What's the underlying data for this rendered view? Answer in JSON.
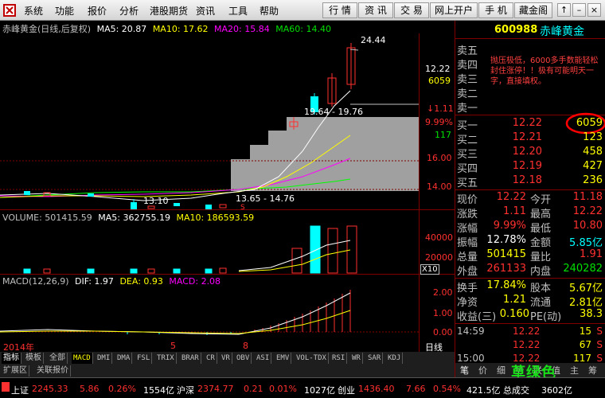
{
  "menubar": {
    "items": [
      "系统",
      "功能",
      "报价",
      "分析",
      "港股期货",
      "资讯",
      "工具",
      "帮助"
    ],
    "buttons": [
      "行 情",
      "资 讯",
      "交 易",
      "网上开户",
      "手 机",
      "藏金阁"
    ],
    "window_controls": [
      "↑",
      "–",
      "×"
    ]
  },
  "chart": {
    "title": "赤峰黄金(日线,后复权)",
    "ma5": "MA5: 20.87",
    "ma10": "MA10: 17.62",
    "ma20": "MA20: 15.84",
    "ma60": "MA60: 14.40",
    "price_axis": [
      "16.00",
      "14.00"
    ],
    "ann_high": "24.44",
    "ann_mid": "19.64 - 19.76",
    "ann_low1": "13.10",
    "ann_low2": "13.65 - 14.76",
    "marker_s": "S",
    "cursor_price": "12.22",
    "cursor_vol": "6059",
    "cursor_chg": "↓1.11",
    "cursor_pct": "9.99%",
    "cursor_cnt": "117",
    "volume_line": {
      "vol": "VOLUME: 501415.59",
      "ma5": "MA5: 362755.19",
      "ma10": "MA10: 186593.59"
    },
    "vol_axis": [
      "40000",
      "20000"
    ],
    "vol_unit": "X10",
    "macd_line": {
      "title": "MACD(12,26,9)",
      "dif": "DIF: 1.97",
      "dea": "DEA: 0.93",
      "macd": "MACD: 2.08"
    },
    "macd_axis": [
      "2.00",
      "1.00",
      "0.00"
    ],
    "date_labels": [
      "2014年",
      "5",
      "8"
    ],
    "period": "日线",
    "colors": {
      "up": "#ff3030",
      "down": "#00ffff",
      "ma5": "#ffffff",
      "ma10": "#ffff00",
      "ma20": "#ff00ff",
      "ma60": "#00ff00",
      "grid": "#800000"
    }
  },
  "tabs": [
    "指标",
    "模板",
    "全部",
    "MACD",
    "DMI",
    "DMA",
    "FSL",
    "TRIX",
    "BRAR",
    "CR",
    "VR",
    "OBV",
    "ASI",
    "EMV",
    "VOL-TDX",
    "RSI",
    "WR",
    "SAR",
    "KDJ"
  ],
  "tabs2": [
    "扩展区",
    "关联报价"
  ],
  "quote": {
    "code": "600988",
    "name": "赤峰黄金",
    "notice": "抛压极低，6000多手数能轻松封住涨停！！极有可能明天一字，直接填权。",
    "sell": [
      {
        "label": "卖五",
        "price": "",
        "vol": ""
      },
      {
        "label": "卖四",
        "price": "",
        "vol": ""
      },
      {
        "label": "卖三",
        "price": "",
        "vol": ""
      },
      {
        "label": "卖二",
        "price": "",
        "vol": ""
      },
      {
        "label": "卖一",
        "price": "",
        "vol": ""
      }
    ],
    "buy": [
      {
        "label": "买一",
        "price": "12.22",
        "vol": "6059"
      },
      {
        "label": "买二",
        "price": "12.21",
        "vol": "123"
      },
      {
        "label": "买三",
        "price": "12.20",
        "vol": "458"
      },
      {
        "label": "买四",
        "price": "12.19",
        "vol": "427"
      },
      {
        "label": "买五",
        "price": "12.18",
        "vol": "236"
      }
    ],
    "stats": [
      {
        "k1": "现价",
        "v1": "12.22",
        "k2": "今开",
        "v2": "11.18"
      },
      {
        "k1": "涨跌",
        "v1": "1.11",
        "k2": "最高",
        "v2": "12.22"
      },
      {
        "k1": "涨幅",
        "v1": "9.99%",
        "k2": "最低",
        "v2": "10.80"
      },
      {
        "k1": "振幅",
        "v1": "12.78%",
        "k2": "金额",
        "v2": "5.85亿"
      },
      {
        "k1": "总量",
        "v1": "501415",
        "k2": "量比",
        "v2": "1.91"
      },
      {
        "k1": "外盘",
        "v1": "261133",
        "k2": "内盘",
        "v2": "240282"
      }
    ],
    "stats2": [
      {
        "k1": "换手",
        "v1": "17.84%",
        "k2": "股本",
        "v2": "5.67亿"
      },
      {
        "k1": "净资",
        "v1": "1.21",
        "k2": "流通",
        "v2": "2.81亿"
      },
      {
        "k1": "收益(三)",
        "v1": "0.160",
        "k2": "PE(动)",
        "v2": "38.3"
      }
    ],
    "ticks": [
      {
        "time": "14:59",
        "price": "12.22",
        "vol": "15",
        "side": "S"
      },
      {
        "time": "",
        "price": "12.22",
        "vol": "67",
        "side": "S"
      },
      {
        "time": "15:00",
        "price": "12.22",
        "vol": "117",
        "side": "S"
      }
    ],
    "rtabs": [
      "笔",
      "价",
      "细",
      "势",
      "联",
      "值",
      "主",
      "筹"
    ],
    "watermark": "草绿色"
  },
  "status": {
    "sh_label": "上证",
    "sh_idx": "2245.33",
    "sh_chg": "5.86",
    "sh_pct": "0.26%",
    "sh_amt": "1554亿",
    "sz_label": "沪深",
    "sz_idx": "2374.77",
    "sz_chg": "0.21",
    "sz_pct": "0.01%",
    "sz_amt": "1027亿",
    "cy_label": "创业",
    "cy_idx": "1436.40",
    "cy_chg": "7.66",
    "cy_pct": "0.54%",
    "cy_amt": "421.5亿",
    "deal_label": "总成交",
    "deal_amt": "3602亿"
  }
}
